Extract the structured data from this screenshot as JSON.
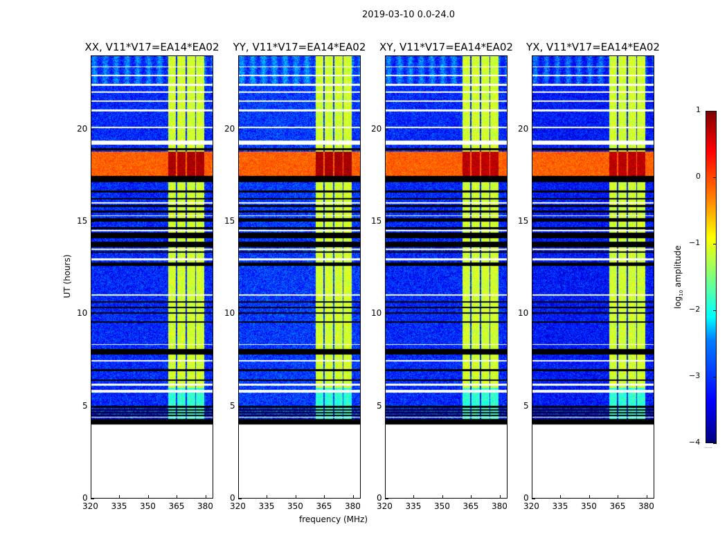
{
  "chart_data": {
    "type": "heatmap",
    "title": "2019-03-10 0.0-24.0",
    "xlabel": "frequency (MHz)",
    "ylabel": "UT (hours)",
    "xlim": [
      320,
      384
    ],
    "ylim": [
      0,
      24
    ],
    "xticks": [
      "320",
      "335",
      "350",
      "365",
      "380"
    ],
    "xtick_values": [
      320,
      335,
      350,
      365,
      380
    ],
    "yticks": [
      "0",
      "5",
      "10",
      "15",
      "20"
    ],
    "ytick_values": [
      0,
      5,
      10,
      15,
      20
    ],
    "panels": [
      {
        "title": "XX, V11*V17=EA14*EA02",
        "band_level": 0.5,
        "bg_level": -3.2
      },
      {
        "title": "YY, V11*V17=EA14*EA02",
        "band_level": 0.5,
        "bg_level": -3.1
      },
      {
        "title": "XY, V11*V17=EA14*EA02",
        "band_level": 0.4,
        "bg_level": -3.2
      },
      {
        "title": "YX, V11*V17=EA14*EA02",
        "band_level": 0.4,
        "bg_level": -3.3
      }
    ],
    "data_start_hour": 4.0,
    "signal_channels_mhz": [
      [
        360.5,
        364.8
      ],
      [
        365.3,
        369.8
      ],
      [
        370.3,
        374.8
      ],
      [
        375.3,
        379.5
      ]
    ],
    "signal_level": -1.1,
    "bright_band_hours": [
      17.5,
      18.8
    ],
    "bright_band_level": -0.1,
    "flagged_hours": [
      [
        4.0,
        4.3
      ],
      [
        4.45,
        4.5
      ],
      [
        4.6,
        4.65
      ],
      [
        4.75,
        4.8
      ],
      [
        4.9,
        5.0
      ],
      [
        6.35,
        6.45
      ],
      [
        6.9,
        7.0
      ],
      [
        7.8,
        8.1
      ],
      [
        9.5,
        9.6
      ],
      [
        10.0,
        10.1
      ],
      [
        10.3,
        10.4
      ],
      [
        10.6,
        10.7
      ],
      [
        12.6,
        12.8
      ],
      [
        13.3,
        13.4
      ],
      [
        13.6,
        13.9
      ],
      [
        14.1,
        14.4
      ],
      [
        14.6,
        14.7
      ],
      [
        15.0,
        15.2
      ],
      [
        15.5,
        15.6
      ],
      [
        15.8,
        15.9
      ],
      [
        16.2,
        16.3
      ],
      [
        16.6,
        16.7
      ],
      [
        17.15,
        17.5
      ],
      [
        18.9,
        19.0
      ]
    ],
    "gap_hours": [
      [
        4.35,
        4.42
      ],
      [
        5.7,
        5.85
      ],
      [
        6.1,
        6.2
      ],
      [
        7.4,
        7.5
      ],
      [
        8.3,
        8.35
      ],
      [
        11.0,
        11.05
      ],
      [
        12.9,
        13.0
      ],
      [
        13.45,
        13.55
      ],
      [
        14.5,
        14.55
      ],
      [
        15.3,
        15.35
      ],
      [
        16.0,
        16.05
      ],
      [
        19.2,
        19.4
      ],
      [
        20.1,
        20.15
      ],
      [
        21.0,
        21.1
      ],
      [
        21.5,
        21.6
      ],
      [
        22.0,
        22.1
      ],
      [
        22.4,
        22.5
      ],
      [
        22.9,
        23.0
      ],
      [
        23.4,
        23.45
      ]
    ],
    "colorbar": {
      "label": "log10 amplitude",
      "label_main": "log",
      "label_sub": "10",
      "label_rest": " amplitude",
      "range": [
        -4,
        1
      ],
      "ticks": [
        "1",
        "0",
        "−1",
        "−2",
        "−3",
        "−4"
      ],
      "tick_values": [
        1,
        0,
        -1,
        -2,
        -3,
        -4
      ],
      "colormap": "jet"
    }
  }
}
